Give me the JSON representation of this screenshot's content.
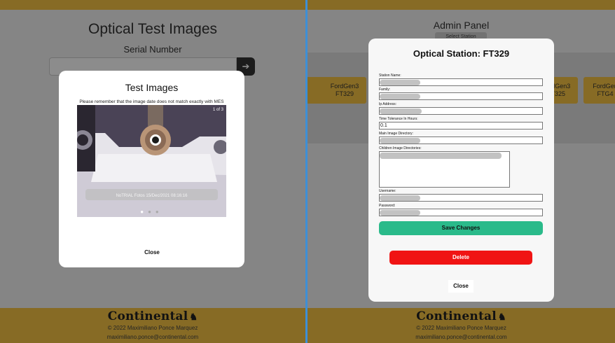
{
  "left": {
    "page_title": "Optical Test Images",
    "serial_label": "Serial Number",
    "serial_value": "",
    "modal": {
      "title": "Test Images",
      "note": "Please remember that the image date does not match exactly with MES",
      "counter": "1 of 3",
      "caption": "NoTRIAL Fotos 15/Dec/2021 08:16:16",
      "close_label": "Close"
    }
  },
  "right": {
    "admin_title": "Admin Panel",
    "admin_button": "Select Station",
    "stations": [
      {
        "line1": "",
        "line2": ""
      },
      {
        "line1": "FordGen3",
        "line2": "FT329"
      },
      {
        "line1": "FordGen3",
        "line2": "FT325"
      },
      {
        "line1": "FordGen",
        "line2": "FTG4"
      }
    ],
    "modal": {
      "title": "Optical Station: FT329",
      "fields": {
        "station_name": {
          "label": "Station Name:",
          "value": ""
        },
        "family": {
          "label": "Family:",
          "value": ""
        },
        "ip_address": {
          "label": "Ip Address:",
          "value": ""
        },
        "time_tolerance": {
          "label": "Time Tolerance In Hours:",
          "value": "0.1"
        },
        "main_dir": {
          "label": "Main Image Directory:",
          "value": ""
        },
        "children_dirs": {
          "label": "Children Image Directories:",
          "value": ""
        },
        "username": {
          "label": "Username:",
          "value": ""
        },
        "password": {
          "label": "Password:",
          "value": ""
        }
      },
      "save_label": "Save Changes",
      "delete_label": "Delete",
      "close_label": "Close"
    }
  },
  "footer": {
    "logo": "Continental",
    "copyright": "© 2022 Maximiliano Ponce Marquez",
    "email": "maximiliano.ponce@continental.com"
  },
  "colors": {
    "brand_yellow": "#f6c344",
    "save_green": "#2aba8a",
    "delete_red": "#f01414",
    "divider_blue": "#3d8fd6"
  }
}
